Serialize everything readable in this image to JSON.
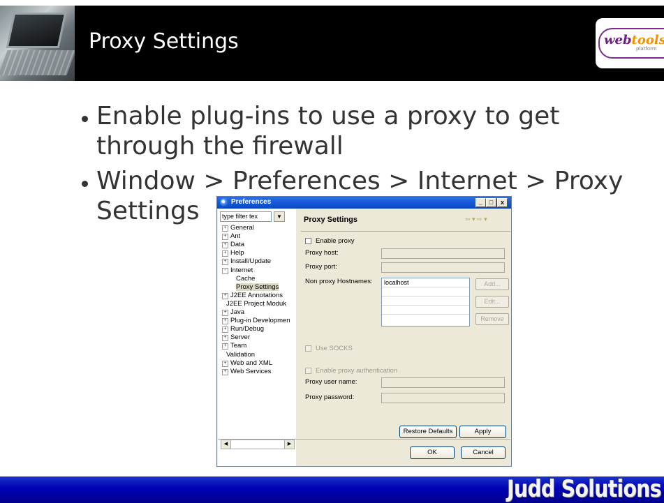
{
  "slide": {
    "title": "Proxy Settings",
    "bullets": [
      {
        "line1": "Enable plug-ins to use a proxy to get",
        "line2": "through the firewall"
      },
      {
        "line1": "Window > Preferences > Internet > Proxy",
        "line2": "Settings"
      }
    ],
    "logo_text_web": "web",
    "logo_text_tools": "tools",
    "logo_sub": "platform",
    "footer_brand": "Judd Solutions"
  },
  "dialog": {
    "title": "Preferences",
    "window_buttons": {
      "minimize": "_",
      "maximize": "□",
      "close": "x"
    },
    "filter_placeholder": "type filter tex",
    "tree": [
      {
        "label": "General",
        "expander": "+",
        "indent": 0
      },
      {
        "label": "Ant",
        "expander": "+",
        "indent": 0
      },
      {
        "label": "Data",
        "expander": "+",
        "indent": 0
      },
      {
        "label": "Help",
        "expander": "+",
        "indent": 0
      },
      {
        "label": "Install/Update",
        "expander": "+",
        "indent": 0
      },
      {
        "label": "Internet",
        "expander": "-",
        "indent": 0
      },
      {
        "label": "Cache",
        "expander": "",
        "indent": 1
      },
      {
        "label": "Proxy Settings",
        "expander": "",
        "indent": 1,
        "selected": true
      },
      {
        "label": "J2EE Annotations",
        "expander": "+",
        "indent": 0
      },
      {
        "label": "J2EE Project Moduk",
        "expander": "",
        "indent": 0
      },
      {
        "label": "Java",
        "expander": "+",
        "indent": 0
      },
      {
        "label": "Plug-in Developmen",
        "expander": "+",
        "indent": 0
      },
      {
        "label": "Run/Debug",
        "expander": "+",
        "indent": 0
      },
      {
        "label": "Server",
        "expander": "+",
        "indent": 0
      },
      {
        "label": "Team",
        "expander": "+",
        "indent": 0
      },
      {
        "label": "Validation",
        "expander": "",
        "indent": 0
      },
      {
        "label": "Web and XML",
        "expander": "+",
        "indent": 0
      },
      {
        "label": "Web Services",
        "expander": "+",
        "indent": 0
      }
    ],
    "page": {
      "title": "Proxy Settings",
      "nav_arrows": "⇦ ▾ ⇨ ▾",
      "enable_proxy": "Enable proxy",
      "proxy_host_label": "Proxy host:",
      "proxy_port_label": "Proxy port:",
      "non_proxy_label": "Non proxy Hostnames:",
      "non_proxy_hosts": [
        "localhost",
        "",
        "",
        ""
      ],
      "add_button": "Add...",
      "edit_button": "Edit...",
      "remove_button": "Remove",
      "use_socks": "Use SOCKS",
      "enable_auth": "Enable proxy authentication",
      "proxy_user_label": "Proxy user name:",
      "proxy_password_label": "Proxy password:",
      "restore_defaults": "Restore Defaults",
      "apply": "Apply"
    },
    "ok": "OK",
    "cancel": "Cancel"
  }
}
